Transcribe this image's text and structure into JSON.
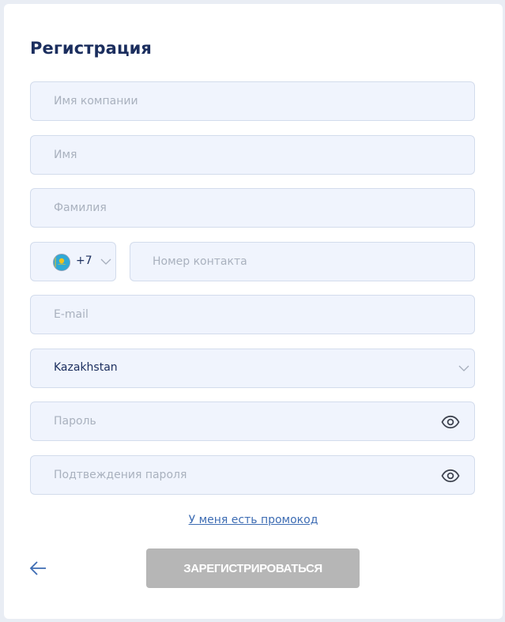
{
  "form": {
    "title": "Регистрация",
    "company": {
      "placeholder": "Имя компании",
      "value": ""
    },
    "first_name": {
      "placeholder": "Имя",
      "value": ""
    },
    "last_name": {
      "placeholder": "Фамилия",
      "value": ""
    },
    "phone": {
      "country_code": "+7",
      "flag_icon": "kazakhstan-flag-icon",
      "placeholder": "Номер контакта",
      "value": ""
    },
    "email": {
      "placeholder": "E-mail",
      "value": ""
    },
    "country": {
      "selected": "Kazakhstan"
    },
    "password": {
      "placeholder": "Пароль",
      "value": ""
    },
    "password_confirm": {
      "placeholder": "Подтвеждения пароля",
      "value": ""
    },
    "promo_link": "У меня есть промокод",
    "submit_label": "ЗАРЕГИСТРИРОВАТЬСЯ"
  },
  "colors": {
    "title": "#1b2e5e",
    "field_bg": "#f0f4fd",
    "field_border": "#d3dcec",
    "link": "#3d6cb3",
    "submit_disabled": "#b6b6b6"
  }
}
